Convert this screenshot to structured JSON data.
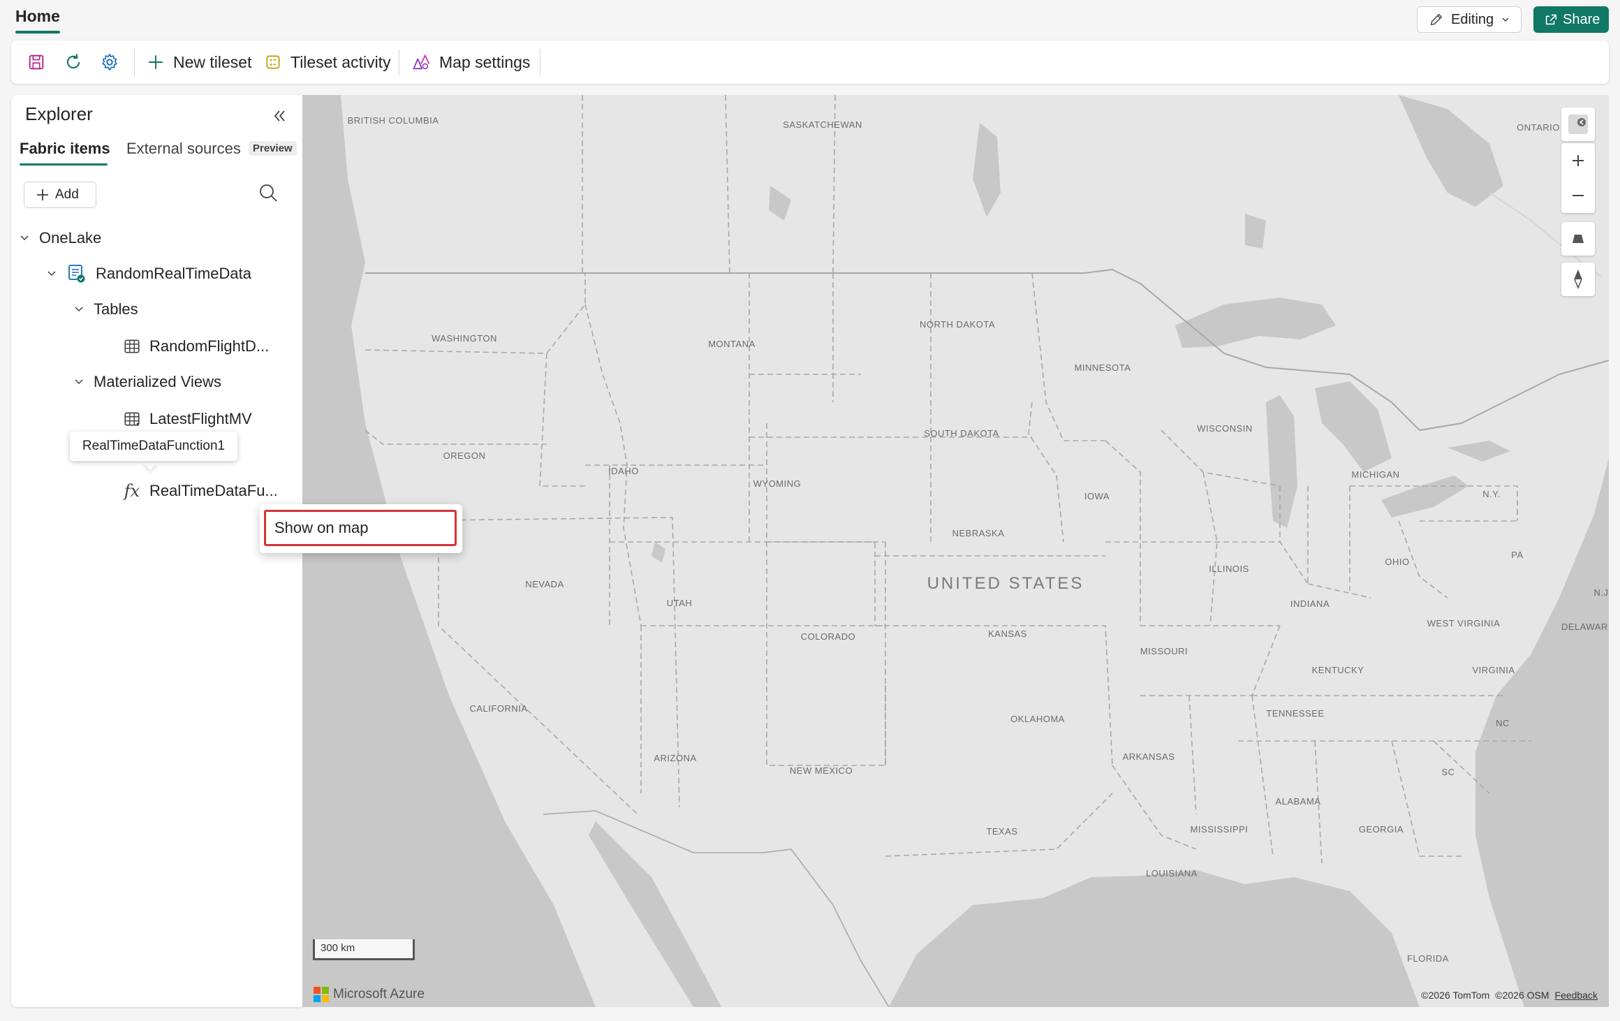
{
  "header": {
    "tab_label": "Home",
    "mode_label": "Editing",
    "share_label": "Share"
  },
  "ribbon": {
    "new_tileset": "New tileset",
    "tileset_activity": "Tileset activity",
    "map_settings": "Map settings"
  },
  "explorer": {
    "title": "Explorer",
    "tabs": [
      "Fabric items",
      "External sources"
    ],
    "preview_badge": "Preview",
    "add_label": "Add",
    "tree": {
      "onelake": "OneLake",
      "database": "RandomRealTimeData",
      "tables_folder": "Tables",
      "table_item": "RandomFlightD...",
      "views_folder": "Materialized Views",
      "view_item": "LatestFlightMV",
      "function_item": "RealTimeDataFu..."
    },
    "tooltip": "RealTimeDataFunction1",
    "context_menu": [
      "Show on map"
    ]
  },
  "map": {
    "country": "UNITED STATES",
    "regions": [
      "BRITISH COLUMBIA",
      "SASKATCHEWAN",
      "ONTARIO",
      "WASHINGTON",
      "MONTANA",
      "NORTH DAKOTA",
      "MINNESOTA",
      "OREGON",
      "IDAHO",
      "WYOMING",
      "SOUTH DAKOTA",
      "WISCONSIN",
      "MICHIGAN",
      "N.Y.",
      "IOWA",
      "NEBRASKA",
      "ILLINOIS",
      "OHIO",
      "PA",
      "N.J.",
      "NEVADA",
      "UTAH",
      "COLORADO",
      "KANSAS",
      "MISSOURI",
      "INDIANA",
      "WEST VIRGINIA",
      "DELAWARE",
      "KENTUCKY",
      "VIRGINIA",
      "CALIFORNIA",
      "OKLAHOMA",
      "TENNESSEE",
      "NC",
      "ARIZONA",
      "NEW MEXICO",
      "ARKANSAS",
      "SC",
      "ALABAMA",
      "MISSISSIPPI",
      "GEORGIA",
      "TEXAS",
      "LOUISIANA",
      "FLORIDA"
    ],
    "scale": "300 km",
    "brand": "Microsoft Azure",
    "attribution": [
      "©2026 TomTom",
      "©2026 OSM",
      "Feedback"
    ],
    "colors": {
      "land": "#e6e6e6",
      "water": "#c8c8c8",
      "border": "#a8a8a8"
    }
  },
  "colors": {
    "accent": "#117865",
    "highlight": "#d13438"
  }
}
